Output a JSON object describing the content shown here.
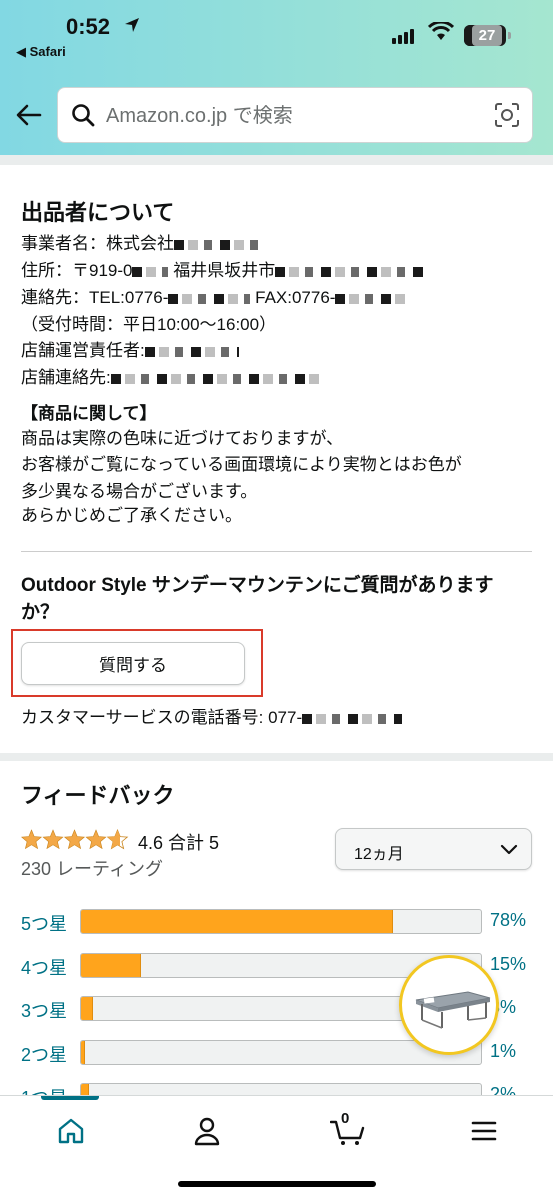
{
  "status_bar": {
    "time": "0:52",
    "back_app": "◀ Safari",
    "battery": "27"
  },
  "search": {
    "placeholder": "Amazon.co.jp で検索"
  },
  "seller": {
    "heading": "出品者について",
    "lines": [
      "事業者名：株式会社",
      "住所：〒919-0",
      "福井県坂井市",
      "連絡先：TEL:0776-",
      "FAX:0776-",
      "（受付時間：平日10:00〜16:00）",
      "店舗運営責任者:",
      "店舗連絡先:"
    ],
    "note_heading": "【商品に関して】",
    "note_lines": [
      "商品は実際の色味に近づけておりますが、",
      "お客様がご覧になっている画面環境により実物とはお色が",
      "多少異なる場合がございます。",
      "あらかじめご了承ください。"
    ]
  },
  "question": {
    "heading": "Outdoor Style サンデーマウンテンにご質問がありますか？",
    "button_label": "質問する",
    "customer_service": "カスタマーサービスの電話番号: 077-"
  },
  "feedback": {
    "heading": "フィードバック",
    "rating_text": "4.6 合計 5",
    "rating_count": "230 レーティング",
    "period": "12ヵ月",
    "bars": [
      {
        "label": "5つ星",
        "percent": 78,
        "percent_label": "78%"
      },
      {
        "label": "4つ星",
        "percent": 15,
        "percent_label": "15%"
      },
      {
        "label": "3つ星",
        "percent": 3,
        "percent_label": "3%"
      },
      {
        "label": "2つ星",
        "percent": 1,
        "percent_label": "1%"
      },
      {
        "label": "1つ星",
        "percent": 2,
        "percent_label": "2%"
      }
    ]
  },
  "bottom_nav": {
    "items": [
      "home-icon",
      "account-icon",
      "cart-icon",
      "menu-icon"
    ],
    "cart_count": "0"
  },
  "colors": {
    "accent": "#007185",
    "bar": "#ffa41c",
    "highlight": "#d93a2a"
  }
}
